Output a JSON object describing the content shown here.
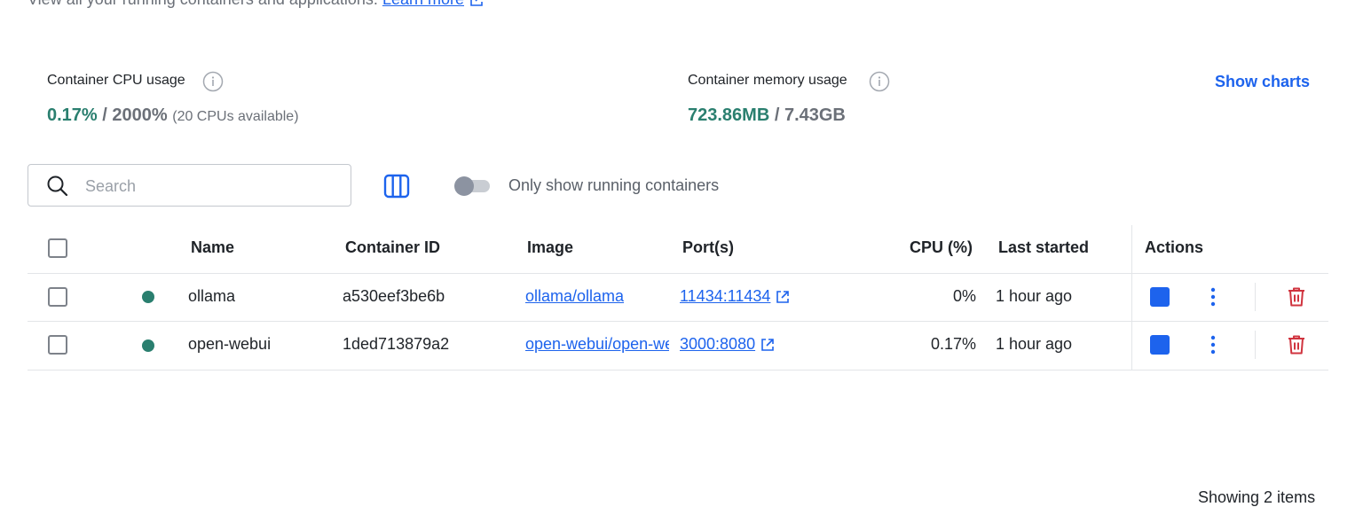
{
  "header": {
    "subtitle": "View all your running containers and applications.",
    "learn_more": "Learn more"
  },
  "stats": {
    "cpu": {
      "label": "Container CPU usage",
      "used": "0.17%",
      "separator": " / ",
      "total": "2000%",
      "note": "(20 CPUs available)"
    },
    "memory": {
      "label": "Container memory usage",
      "used": "723.86MB",
      "separator": " / ",
      "total": "7.43GB"
    },
    "show_charts": "Show charts"
  },
  "toolbar": {
    "search_placeholder": "Search",
    "search_value": "",
    "toggle_label": "Only show running containers",
    "toggle_on": false
  },
  "table": {
    "columns": {
      "name": "Name",
      "container_id": "Container ID",
      "image": "Image",
      "ports": "Port(s)",
      "cpu": "CPU (%)",
      "last_started": "Last started",
      "actions": "Actions"
    },
    "rows": [
      {
        "name": "ollama",
        "container_id": "a530eef3be6b",
        "image": "ollama/ollama",
        "ports": "11434:11434",
        "cpu": "0%",
        "last_started": "1 hour ago",
        "status": "running"
      },
      {
        "name": "open-webui",
        "container_id": "1ded713879a2",
        "image": "open-webui/open-webui",
        "ports": "3000:8080",
        "cpu": "0.17%",
        "last_started": "1 hour ago",
        "status": "running"
      }
    ]
  },
  "footer": {
    "items_text": "Showing 2 items"
  },
  "colors": {
    "accent": "#1d63ed",
    "running": "#2a7f6f",
    "danger": "#d0343f"
  }
}
